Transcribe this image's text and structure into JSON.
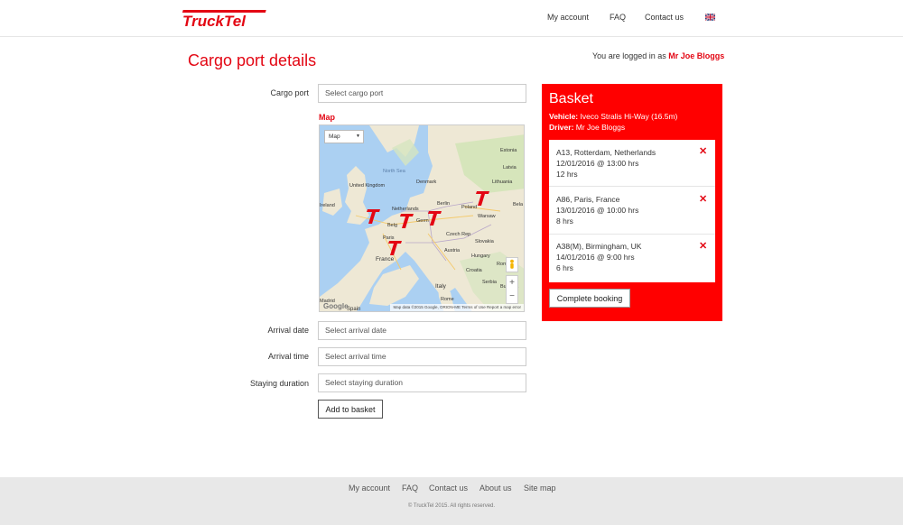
{
  "brand": {
    "name": "TruckTel",
    "color": "#e30613"
  },
  "nav": {
    "my_account": "My account",
    "faq": "FAQ",
    "contact_us": "Contact us",
    "language_icon": "uk-flag-icon"
  },
  "page": {
    "title": "Cargo port details",
    "logged_prefix": "You are logged in as",
    "user": "Mr Joe Bloggs"
  },
  "form": {
    "cargo_port_label": "Cargo port",
    "cargo_port_placeholder": "Select cargo port",
    "map_label": "Map",
    "arrival_date_label": "Arrival date",
    "arrival_date_placeholder": "Select arrival date",
    "arrival_time_label": "Arrival time",
    "arrival_time_placeholder": "Select arrival time",
    "staying_label": "Staying duration",
    "staying_placeholder": "Select staying duration",
    "add_button": "Add to basket"
  },
  "map": {
    "type_selector": "Map",
    "zoom_in": "+",
    "zoom_out": "−",
    "google": "Google",
    "attribution": "Map data ©2015 Google, ORION-ME   Terms of Use   Report a map error",
    "labels": [
      "Estonia",
      "Latvia",
      "Lithuania",
      "Denmark",
      "North Sea",
      "United Kingdom",
      "Ireland",
      "Netherlands",
      "Berlin",
      "Poland",
      "Warsaw",
      "Bela",
      "Belg",
      "Germ",
      "Paris",
      "Czech Rep",
      "Slovakia",
      "France",
      "Austria",
      "Hungary",
      "Croatia",
      "Romania",
      "Italy",
      "Serbia",
      "Bulgaria",
      "Spain",
      "Madrid",
      "Rome"
    ]
  },
  "basket": {
    "title": "Basket",
    "vehicle_label": "Vehicle:",
    "vehicle": "Iveco Stralis Hi-Way (16.5m)",
    "driver_label": "Driver:",
    "driver": "Mr Joe Bloggs",
    "items": [
      {
        "place": "A13, Rotterdam, Netherlands",
        "when": "12/01/2016 @ 13:00 hrs",
        "duration": "12 hrs"
      },
      {
        "place": "A86, Paris, France",
        "when": "13/01/2016 @ 10:00 hrs",
        "duration": "8 hrs"
      },
      {
        "place": "A38(M), Birmingham, UK",
        "when": "14/01/2016 @ 9:00 hrs",
        "duration": "6 hrs"
      }
    ],
    "remove_icon": "close-icon",
    "complete_button": "Complete booking"
  },
  "footer": {
    "links": [
      "My account",
      "FAQ",
      "Contact us",
      "About us",
      "Site map"
    ],
    "copyright": "© TruckTel 2015. All rights reserved."
  }
}
